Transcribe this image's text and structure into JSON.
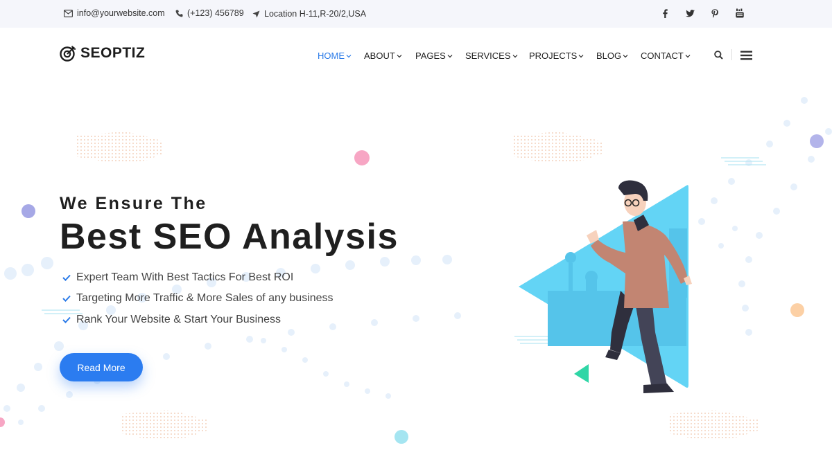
{
  "topbar": {
    "email": "info@yourwebsite.com",
    "phone": "(+123) 456789",
    "location": "Location H-11,R-20/2,USA",
    "social": [
      "facebook-icon",
      "twitter-icon",
      "pinterest-icon",
      "youtube-icon"
    ]
  },
  "header": {
    "logo_text": "SEOPTIZ",
    "nav": [
      {
        "label": "HOME",
        "active": true
      },
      {
        "label": "ABOUT"
      },
      {
        "label": "PAGES"
      },
      {
        "label": "SERVICES"
      },
      {
        "label": "PROJECTS"
      },
      {
        "label": "BLOG"
      },
      {
        "label": "CONTACT"
      }
    ],
    "icons": [
      "search-icon",
      "hamburger-menu-icon"
    ]
  },
  "hero": {
    "subtitle": "We Ensure The",
    "title": "Best SEO Analysis",
    "bullets": [
      "Expert Team With Best Tactics For Best ROI",
      "Targeting More Traffic & More Sales of any business",
      "Rank Your Website & Start Your Business"
    ],
    "button_label": "Read More"
  },
  "colors": {
    "accent": "#2b7be8",
    "button": "#2b7cf0",
    "triangle": "#63d4f5",
    "topbar_bg": "#f5f6fb"
  }
}
